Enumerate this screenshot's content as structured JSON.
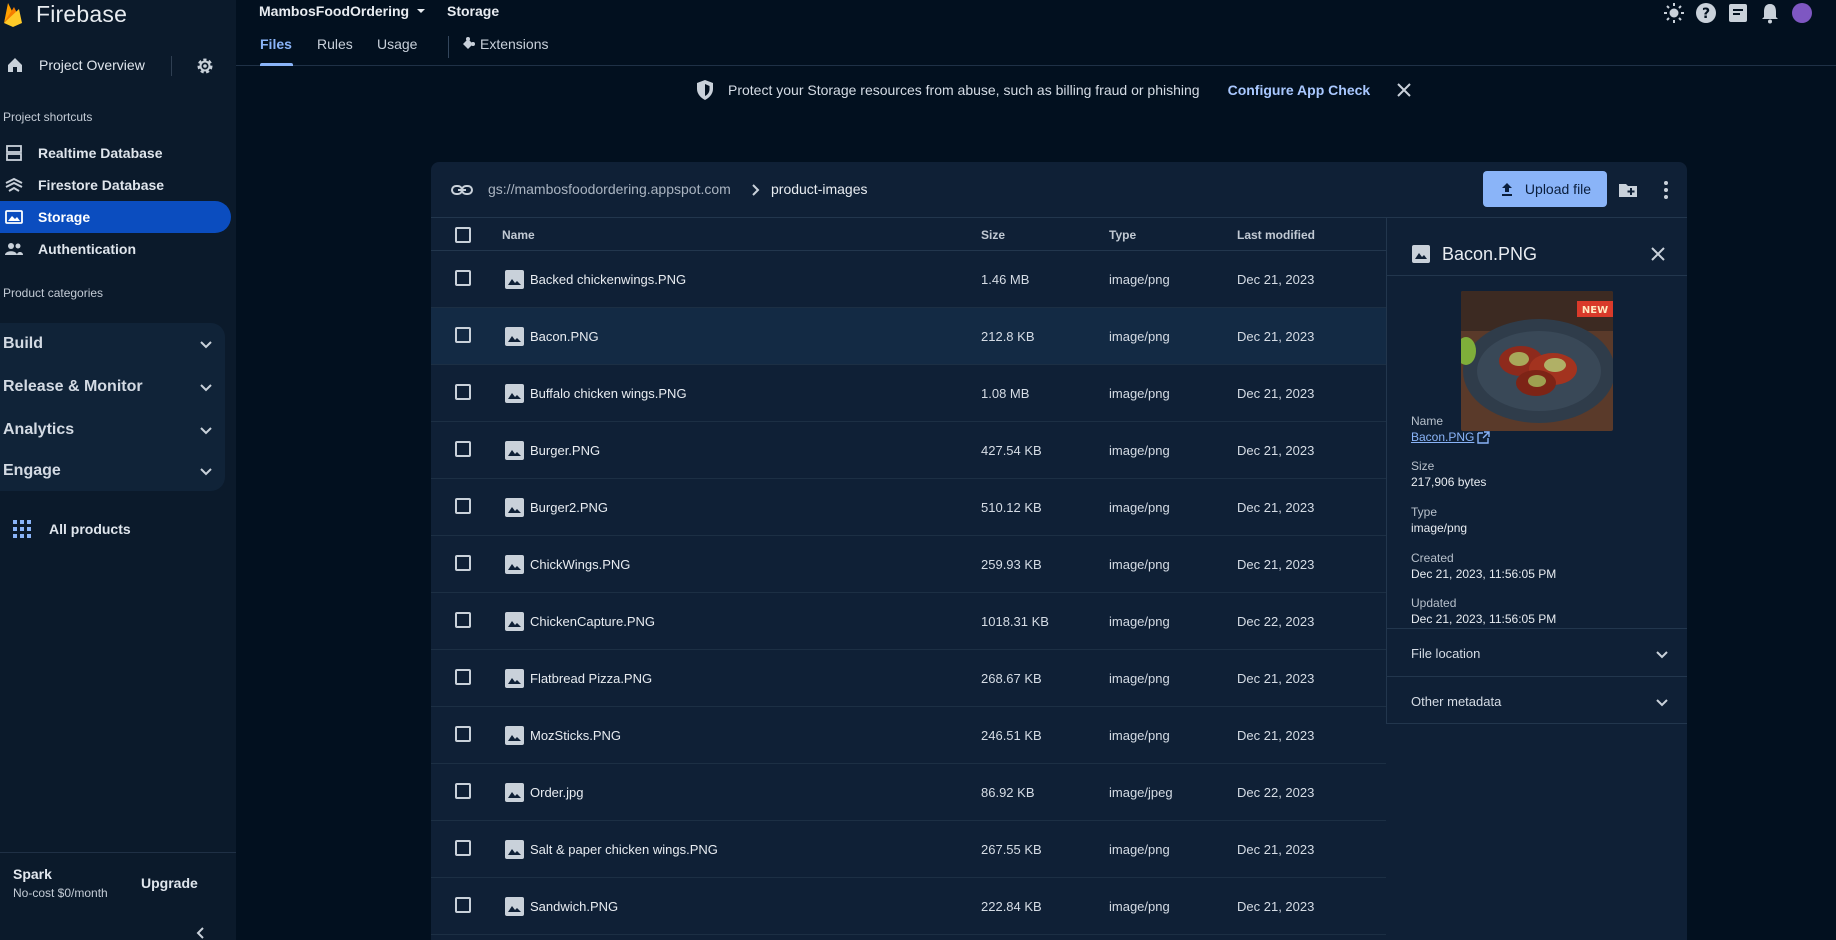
{
  "sidebar": {
    "brand": "Firebase",
    "project_overview": "Project Overview",
    "shortcuts_label": "Project shortcuts",
    "shortcuts": [
      {
        "label": "Realtime Database",
        "icon": "database-icon"
      },
      {
        "label": "Firestore Database",
        "icon": "firestore-icon"
      },
      {
        "label": "Storage",
        "icon": "storage-icon",
        "active": true
      },
      {
        "label": "Authentication",
        "icon": "people-icon"
      }
    ],
    "categories_label": "Product categories",
    "categories": [
      "Build",
      "Release & Monitor",
      "Analytics",
      "Engage"
    ],
    "all_products": "All products",
    "plan": {
      "name": "Spark",
      "subtitle": "No-cost $0/month",
      "upgrade": "Upgrade"
    }
  },
  "header": {
    "project_name": "MambosFoodOrdering",
    "page": "Storage",
    "tabs": [
      "Files",
      "Rules",
      "Usage",
      "Extensions"
    ],
    "active_tab": "Files"
  },
  "banner": {
    "text": "Protect your Storage resources from abuse, such as billing fraud or phishing",
    "action": "Configure App Check"
  },
  "browser": {
    "bucket": "gs://mambosfoodordering.appspot.com",
    "folder": "product-images",
    "upload_label": "Upload file",
    "columns": [
      "Name",
      "Size",
      "Type",
      "Last modified"
    ],
    "files": [
      {
        "name": "Backed chickenwings.PNG",
        "size": "1.46 MB",
        "type": "image/png",
        "modified": "Dec 21, 2023"
      },
      {
        "name": "Bacon.PNG",
        "size": "212.8 KB",
        "type": "image/png",
        "modified": "Dec 21, 2023"
      },
      {
        "name": "Buffalo chicken wings.PNG",
        "size": "1.08 MB",
        "type": "image/png",
        "modified": "Dec 21, 2023"
      },
      {
        "name": "Burger.PNG",
        "size": "427.54 KB",
        "type": "image/png",
        "modified": "Dec 21, 2023"
      },
      {
        "name": "Burger2.PNG",
        "size": "510.12 KB",
        "type": "image/png",
        "modified": "Dec 21, 2023"
      },
      {
        "name": "ChickWings.PNG",
        "size": "259.93 KB",
        "type": "image/png",
        "modified": "Dec 21, 2023"
      },
      {
        "name": "ChickenCapture.PNG",
        "size": "1018.31 KB",
        "type": "image/png",
        "modified": "Dec 22, 2023"
      },
      {
        "name": "Flatbread Pizza.PNG",
        "size": "268.67 KB",
        "type": "image/png",
        "modified": "Dec 21, 2023"
      },
      {
        "name": "MozSticks.PNG",
        "size": "246.51 KB",
        "type": "image/png",
        "modified": "Dec 21, 2023"
      },
      {
        "name": "Order.jpg",
        "size": "86.92 KB",
        "type": "image/jpeg",
        "modified": "Dec 22, 2023"
      },
      {
        "name": "Salt & paper chicken wings.PNG",
        "size": "267.55 KB",
        "type": "image/png",
        "modified": "Dec 21, 2023"
      },
      {
        "name": "Sandwich.PNG",
        "size": "222.84 KB",
        "type": "image/png",
        "modified": "Dec 21, 2023"
      }
    ]
  },
  "details": {
    "title": "Bacon.PNG",
    "thumb_badge": "NEW",
    "fields": [
      {
        "label": "Name",
        "value": "Bacon.PNG"
      },
      {
        "label": "Size",
        "value": "217,906 bytes"
      },
      {
        "label": "Type",
        "value": "image/png"
      },
      {
        "label": "Created",
        "value": "Dec 21, 2023, 11:56:05 PM"
      },
      {
        "label": "Updated",
        "value": "Dec 21, 2023, 11:56:05 PM"
      }
    ],
    "sections": [
      "File location",
      "Other metadata"
    ]
  },
  "colors": {
    "accent": "#8ab4f8",
    "active_nav": "#0b4dbf",
    "background": "#02101f",
    "sidebar": "#0b1a2b"
  }
}
